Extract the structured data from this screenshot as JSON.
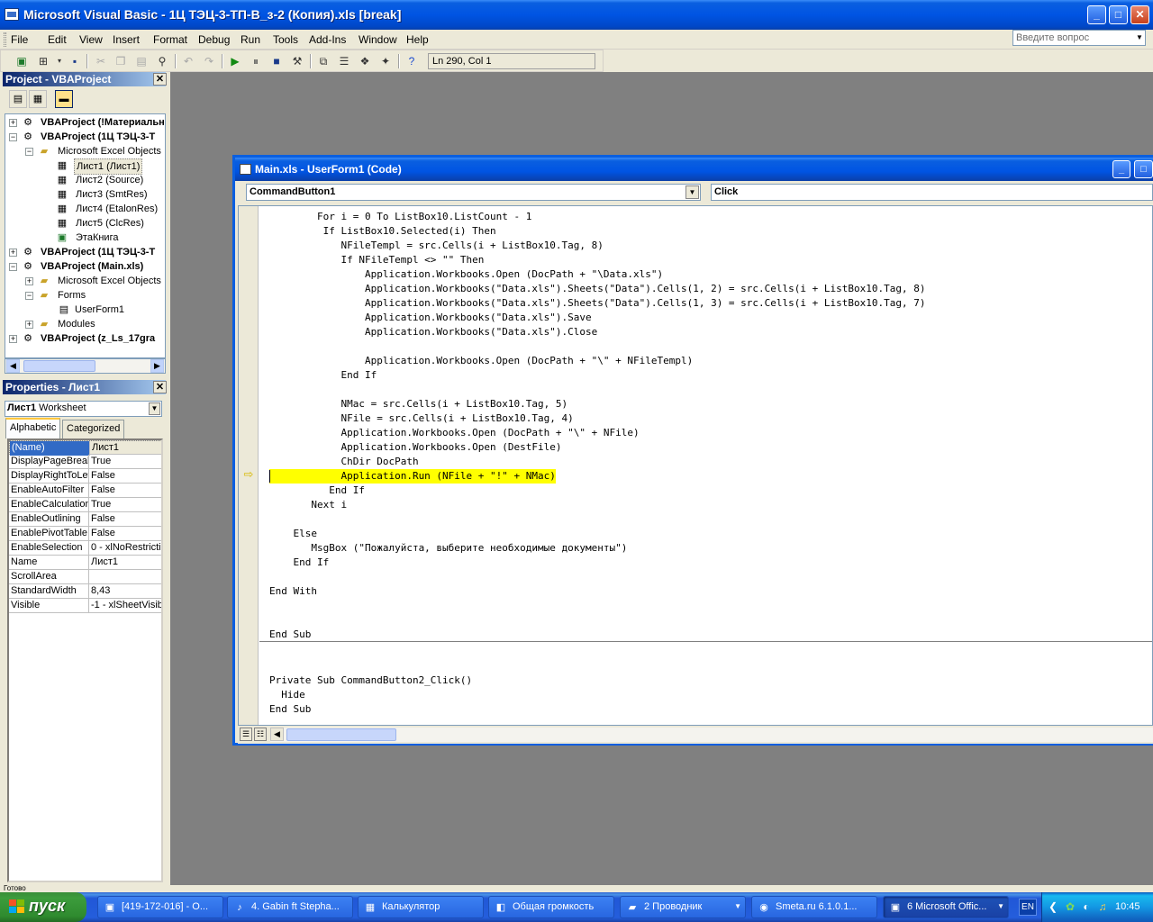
{
  "window": {
    "title": "Microsoft Visual Basic - 1Ц ТЭЦ-3-ТП-В_з-2 (Копия).xls [break]"
  },
  "menu": [
    "File",
    "Edit",
    "View",
    "Insert",
    "Format",
    "Debug",
    "Run",
    "Tools",
    "Add-Ins",
    "Window",
    "Help"
  ],
  "help_search": {
    "placeholder": "Введите вопрос"
  },
  "toolbar": {
    "position": "Ln 290, Col 1"
  },
  "project": {
    "title": "Project - VBAProject",
    "tree": [
      "VBAProject (!Материальн",
      "VBAProject (1Ц ТЭЦ-3-Т",
      "Microsoft Excel Objects",
      "Лист1 (Лист1)",
      "Лист2 (Source)",
      "Лист3 (SmtRes)",
      "Лист4 (EtalonRes)",
      "Лист5 (ClcRes)",
      "ЭтаКнига",
      "VBAProject (1Ц ТЭЦ-3-Т",
      "VBAProject (Main.xls)",
      "Microsoft Excel Objects",
      "Forms",
      "UserForm1",
      "Modules",
      "VBAProject (z_Ls_17gra"
    ]
  },
  "properties": {
    "title": "Properties - Лист1",
    "object_name": "Лист1",
    "object_type": "Worksheet",
    "tabs": [
      "Alphabetic",
      "Categorized"
    ],
    "rows": [
      {
        "name": "(Name)",
        "value": "Лист1"
      },
      {
        "name": "DisplayPageBreak",
        "value": "True"
      },
      {
        "name": "DisplayRightToLef",
        "value": "False"
      },
      {
        "name": "EnableAutoFilter",
        "value": "False"
      },
      {
        "name": "EnableCalculation",
        "value": "True"
      },
      {
        "name": "EnableOutlining",
        "value": "False"
      },
      {
        "name": "EnablePivotTable",
        "value": "False"
      },
      {
        "name": "EnableSelection",
        "value": "0 - xlNoRestrictio"
      },
      {
        "name": "Name",
        "value": "Лист1"
      },
      {
        "name": "ScrollArea",
        "value": ""
      },
      {
        "name": "StandardWidth",
        "value": "8,43"
      },
      {
        "name": "Visible",
        "value": "-1 - xlSheetVisib"
      }
    ]
  },
  "code_window": {
    "title": "Main.xls - UserForm1 (Code)",
    "object_combo": "CommandButton1",
    "proc_combo": "Click",
    "lines": [
      "        For i = 0 To ListBox10.ListCount - 1",
      "         If ListBox10.Selected(i) Then",
      "            NFileTempl = src.Cells(i + ListBox10.Tag, 8)",
      "            If NFileTempl <> \"\" Then",
      "                Application.Workbooks.Open (DocPath + \"\\Data.xls\")",
      "                Application.Workbooks(\"Data.xls\").Sheets(\"Data\").Cells(1, 2) = src.Cells(i + ListBox10.Tag, 8)",
      "                Application.Workbooks(\"Data.xls\").Sheets(\"Data\").Cells(1, 3) = src.Cells(i + ListBox10.Tag, 7)",
      "                Application.Workbooks(\"Data.xls\").Save",
      "                Application.Workbooks(\"Data.xls\").Close",
      "",
      "                Application.Workbooks.Open (DocPath + \"\\\" + NFileTempl)",
      "            End If",
      "",
      "            NMac = src.Cells(i + ListBox10.Tag, 5)",
      "            NFile = src.Cells(i + ListBox10.Tag, 4)",
      "            Application.Workbooks.Open (DocPath + \"\\\" + NFile)",
      "            Application.Workbooks.Open (DestFile)",
      "            ChDir DocPath",
      "            Application.Run (NFile + \"!\" + NMac)",
      "          End If",
      "       Next i",
      "",
      "    Else",
      "       MsgBox (\"Пожалуйста, выберите необходимые документы\")",
      "    End If",
      "",
      "End With",
      "",
      "",
      "End Sub",
      "",
      "",
      "Private Sub CommandButton2_Click()",
      "  Hide",
      "End Sub"
    ]
  },
  "taskbar": {
    "start": "пуск",
    "tasks": [
      "[419-172-016] - O...",
      "4. Gabin ft Stepha...",
      "Калькулятор",
      "Общая громкость",
      "2 Проводник",
      "Smeta.ru  6.1.0.1...",
      "6 Microsoft Offic..."
    ],
    "lang": "EN",
    "clock": "10:45"
  },
  "status": "Готово"
}
